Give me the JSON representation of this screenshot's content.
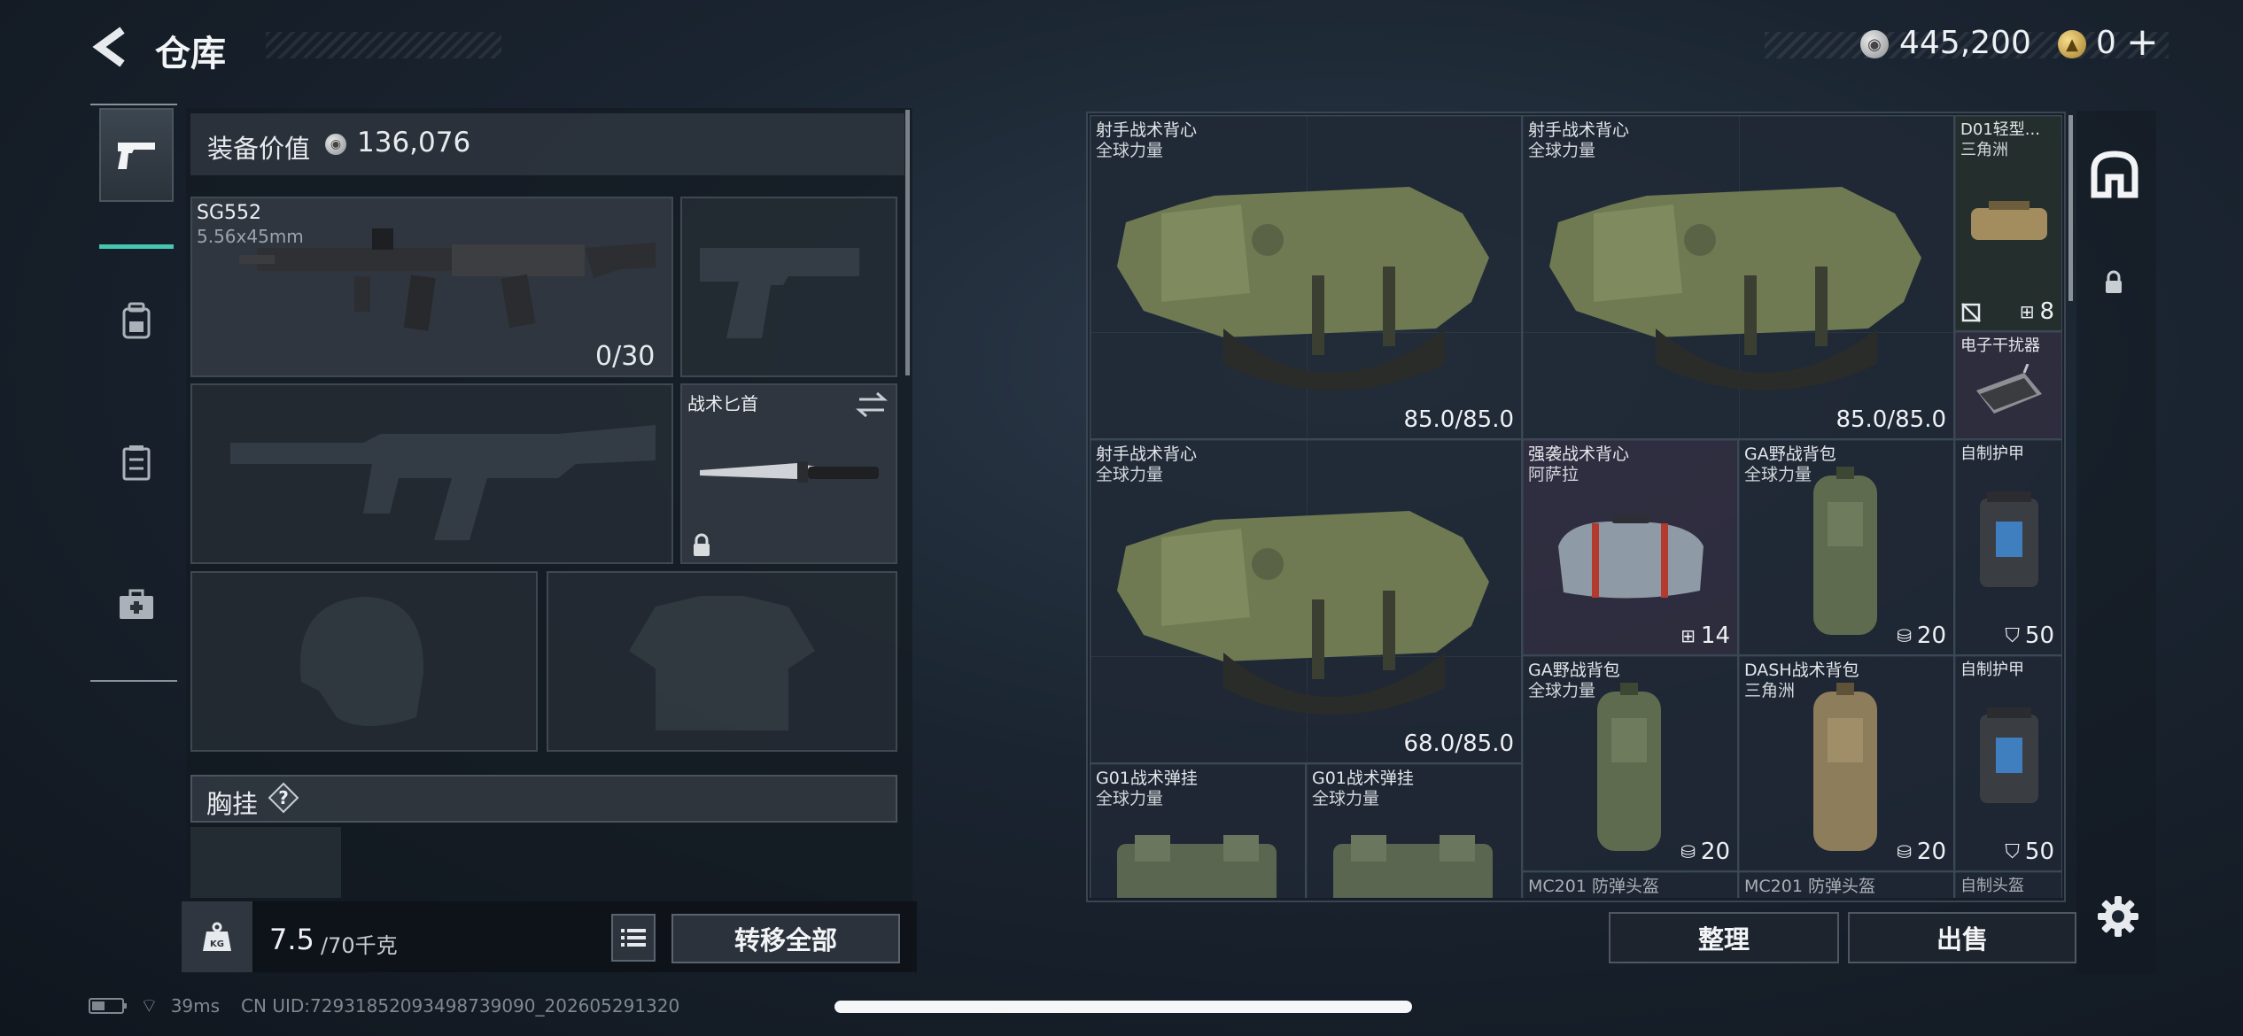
{
  "header": {
    "title": "仓库",
    "currency_amount": "445,200",
    "premium_amount": "0",
    "premium_plus": "+"
  },
  "categories": [
    {
      "name": "weapons",
      "icon": "pistol-icon",
      "active": true
    },
    {
      "name": "backpack",
      "icon": "backpack-icon",
      "active": false
    },
    {
      "name": "rig",
      "icon": "rig-icon",
      "active": false
    },
    {
      "name": "medkit",
      "icon": "medkit-icon",
      "active": false
    }
  ],
  "loadout": {
    "value_label": "装备价值",
    "value_amount": "136,076",
    "primary": {
      "name": "SG552",
      "ammo_type": "5.56x45mm",
      "ammo_count": "0/30"
    },
    "melee": {
      "name": "战术匕首"
    },
    "chest_rig": {
      "label": "胸挂",
      "help": "?"
    },
    "weight": {
      "current": "7.5",
      "max": "/70千克"
    },
    "transfer_label": "转移全部"
  },
  "grid": {
    "items": [
      {
        "name": "射手战术背心",
        "sub": "全球力量",
        "value": "85.0/85.0"
      },
      {
        "name": "射手战术背心",
        "sub": "全球力量",
        "value": "85.0/85.0"
      },
      {
        "name": "D01轻型...",
        "sub": "三角洲",
        "value": "8"
      },
      {
        "name": "电子干扰器",
        "sub": "",
        "value": ""
      },
      {
        "name": "射手战术背心",
        "sub": "全球力量",
        "value": "68.0/85.0"
      },
      {
        "name": "强袭战术背心",
        "sub": "阿萨拉",
        "value": "14"
      },
      {
        "name": "GA野战背包",
        "sub": "全球力量",
        "value": "20"
      },
      {
        "name": "自制护甲",
        "sub": "",
        "value": "50"
      },
      {
        "name": "GA野战背包",
        "sub": "全球力量",
        "value": "20"
      },
      {
        "name": "DASH战术背包",
        "sub": "三角洲",
        "value": "20"
      },
      {
        "name": "自制护甲",
        "sub": "",
        "value": "50"
      },
      {
        "name": "G01战术弹挂",
        "sub": "全球力量",
        "value": ""
      },
      {
        "name": "G01战术弹挂",
        "sub": "全球力量",
        "value": ""
      },
      {
        "name": "MC201 防弹头盔",
        "sub": "",
        "value": ""
      },
      {
        "name": "MC201 防弹头盔",
        "sub": "",
        "value": ""
      },
      {
        "name": "自制头盔",
        "sub": "",
        "value": ""
      }
    ]
  },
  "actions": {
    "sort": "整理",
    "sell": "出售"
  },
  "status": {
    "ping": "39ms",
    "uid": "CN UID:7293185209349873909​0_202605291320"
  },
  "colors": {
    "accent": "#46c6b0",
    "panel": "#141a21",
    "gold": "#c9a24a"
  }
}
